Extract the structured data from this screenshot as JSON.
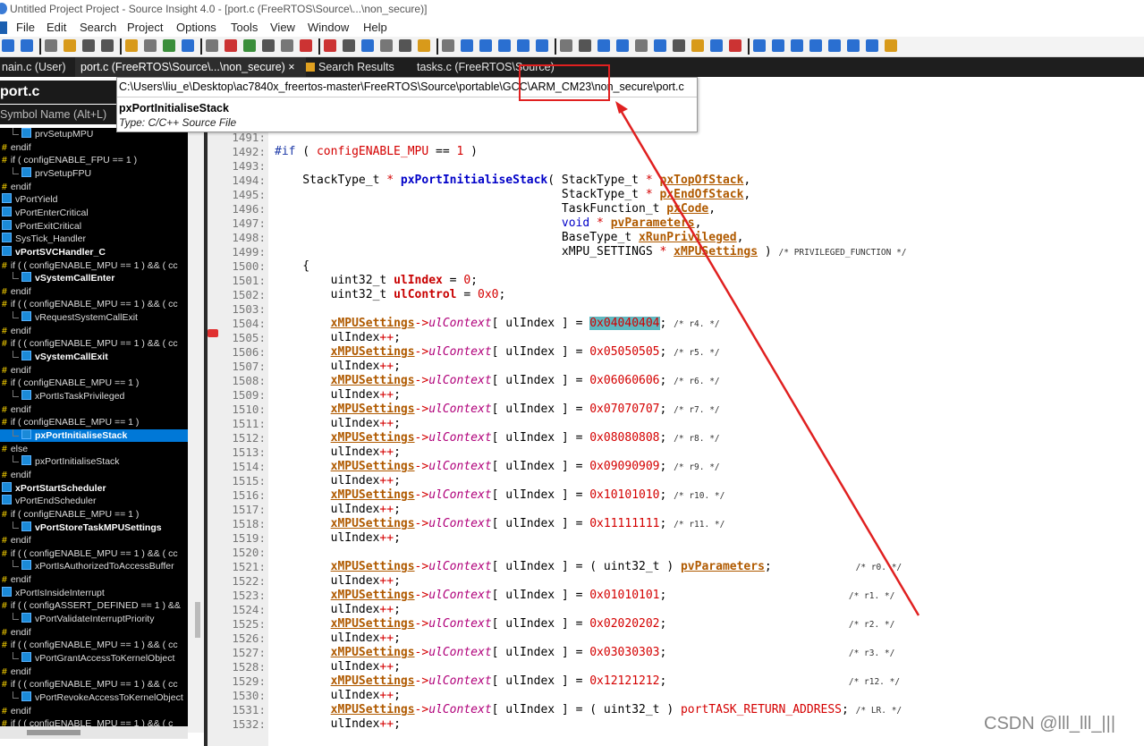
{
  "window": {
    "title": "Untitled Project Project - Source Insight 4.0 - [port.c (FreeRTOS\\Source\\...\\non_secure)]"
  },
  "menu": [
    "File",
    "Edit",
    "Search",
    "Project",
    "Options",
    "Tools",
    "View",
    "Window",
    "Help"
  ],
  "tabs": [
    {
      "label": "nain.c (User)"
    },
    {
      "label": "port.c (FreeRTOS\\Source\\...\\non_secure)",
      "close": "×"
    },
    {
      "label": "Search Results"
    },
    {
      "label": "tasks.c (FreeRTOS\\Source)"
    }
  ],
  "symbol_panel": {
    "title": "port.c",
    "search_placeholder": "Symbol Name (Alt+L)",
    "items": [
      {
        "label": "prvSetupMPU",
        "kind": "func",
        "indent": 1
      },
      {
        "label": "endif",
        "kind": "pp",
        "indent": 0
      },
      {
        "label": "if ( configENABLE_FPU == 1 )",
        "kind": "pp",
        "indent": 0
      },
      {
        "label": "prvSetupFPU",
        "kind": "func",
        "indent": 1
      },
      {
        "label": "endif",
        "kind": "pp",
        "indent": 0
      },
      {
        "label": "vPortYield",
        "kind": "func",
        "indent": 0
      },
      {
        "label": "vPortEnterCritical",
        "kind": "func",
        "indent": 0
      },
      {
        "label": "vPortExitCritical",
        "kind": "func",
        "indent": 0
      },
      {
        "label": "SysTick_Handler",
        "kind": "func",
        "indent": 0
      },
      {
        "label": "vPortSVCHandler_C",
        "kind": "func",
        "indent": 0,
        "bold": true
      },
      {
        "label": "if ( ( configENABLE_MPU == 1 ) && ( cc",
        "kind": "pp",
        "indent": 0
      },
      {
        "label": "vSystemCallEnter",
        "kind": "func",
        "indent": 1,
        "bold": true
      },
      {
        "label": "endif",
        "kind": "pp",
        "indent": 0
      },
      {
        "label": "if ( ( configENABLE_MPU == 1 ) && ( cc",
        "kind": "pp",
        "indent": 0
      },
      {
        "label": "vRequestSystemCallExit",
        "kind": "func",
        "indent": 1
      },
      {
        "label": "endif",
        "kind": "pp",
        "indent": 0
      },
      {
        "label": "if ( ( configENABLE_MPU == 1 ) && ( cc",
        "kind": "pp",
        "indent": 0
      },
      {
        "label": "vSystemCallExit",
        "kind": "func",
        "indent": 1,
        "bold": true
      },
      {
        "label": "endif",
        "kind": "pp",
        "indent": 0
      },
      {
        "label": "if ( configENABLE_MPU == 1 )",
        "kind": "pp",
        "indent": 0
      },
      {
        "label": "xPortIsTaskPrivileged",
        "kind": "func",
        "indent": 1
      },
      {
        "label": "endif",
        "kind": "pp",
        "indent": 0
      },
      {
        "label": "if ( configENABLE_MPU == 1 )",
        "kind": "pp",
        "indent": 0
      },
      {
        "label": "pxPortInitialiseStack",
        "kind": "func",
        "indent": 1,
        "selected": true
      },
      {
        "label": "else",
        "kind": "pp",
        "indent": 0
      },
      {
        "label": "pxPortInitialiseStack",
        "kind": "func",
        "indent": 1
      },
      {
        "label": "endif",
        "kind": "pp",
        "indent": 0
      },
      {
        "label": "xPortStartScheduler",
        "kind": "func",
        "indent": 0,
        "bold": true
      },
      {
        "label": "vPortEndScheduler",
        "kind": "func",
        "indent": 0
      },
      {
        "label": "if ( configENABLE_MPU == 1 )",
        "kind": "pp",
        "indent": 0
      },
      {
        "label": "vPortStoreTaskMPUSettings",
        "kind": "func",
        "indent": 1,
        "bold": true
      },
      {
        "label": "endif",
        "kind": "pp",
        "indent": 0
      },
      {
        "label": "if ( ( configENABLE_MPU == 1 ) && ( cc",
        "kind": "pp",
        "indent": 0
      },
      {
        "label": "xPortIsAuthorizedToAccessBuffer",
        "kind": "func",
        "indent": 1
      },
      {
        "label": "endif",
        "kind": "pp",
        "indent": 0
      },
      {
        "label": "xPortIsInsideInterrupt",
        "kind": "func",
        "indent": 0
      },
      {
        "label": "if ( ( configASSERT_DEFINED == 1 ) &&",
        "kind": "pp",
        "indent": 0
      },
      {
        "label": "vPortValidateInterruptPriority",
        "kind": "func",
        "indent": 1
      },
      {
        "label": "endif",
        "kind": "pp",
        "indent": 0
      },
      {
        "label": "if ( ( configENABLE_MPU == 1 ) && ( cc",
        "kind": "pp",
        "indent": 0
      },
      {
        "label": "vPortGrantAccessToKernelObject",
        "kind": "func",
        "indent": 1
      },
      {
        "label": "endif",
        "kind": "pp",
        "indent": 0
      },
      {
        "label": "if ( ( configENABLE_MPU == 1 ) && ( cc",
        "kind": "pp",
        "indent": 0
      },
      {
        "label": "vPortRevokeAccessToKernelObject",
        "kind": "func",
        "indent": 1
      },
      {
        "label": "endif",
        "kind": "pp",
        "indent": 0
      },
      {
        "label": "if ( ( configENABLE_MPU == 1 ) && ( c",
        "kind": "pp",
        "indent": 0
      }
    ]
  },
  "tooltip": {
    "path": "C:\\Users\\liu_e\\Desktop\\ac7840x_freertos-master\\FreeRTOS\\Source\\portable\\GCC\\ARM_CM23\\non_secure\\port.c",
    "symbol": "pxPortInitialiseStack",
    "type": "Type: C/C++ Source File"
  },
  "code_lines": [
    {
      "n": "1490:",
      "html": "<span class='cm'>/* -----------------------------------------------------------*/</span>"
    },
    {
      "n": "1491:",
      "html": ""
    },
    {
      "n": "1492:",
      "html": "<span class='pp'>#if</span> ( <span class='op'>configENABLE_MPU</span> == <span class='num'>1</span> )"
    },
    {
      "n": "1493:",
      "html": ""
    },
    {
      "n": "1494:",
      "html": "    StackType_t <span class='op'>*</span> <span class='fn'>pxPortInitialiseStack</span>( StackType_t <span class='op'>*</span> <span class='par'>pxTopOfStack</span>,"
    },
    {
      "n": "1495:",
      "html": "                                         StackType_t <span class='op'>*</span> <span class='par'>pxEndOfStack</span>,"
    },
    {
      "n": "1496:",
      "html": "                                         TaskFunction_t <span class='par'>pxCode</span>,"
    },
    {
      "n": "1497:",
      "html": "                                         <span class='kw'>void</span> <span class='op'>*</span> <span class='par'>pvParameters</span>,"
    },
    {
      "n": "1498:",
      "html": "                                         BaseType_t <span class='par'>xRunPrivileged</span>,"
    },
    {
      "n": "1499:",
      "html": "                                         xMPU_SETTINGS <span class='op'>*</span> <span class='par'>xMPUSettings</span> ) <span class='cm'>/* PRIVILEGED_FUNCTION */</span>"
    },
    {
      "n": "1500:",
      "html": "    {"
    },
    {
      "n": "1501:",
      "html": "        uint32_t <span class='var'>ulIndex</span> = <span class='num'>0</span>;"
    },
    {
      "n": "1502:",
      "html": "        uint32_t <span class='var'>ulControl</span> = <span class='num'>0x0</span>;"
    },
    {
      "n": "1503:",
      "html": ""
    },
    {
      "n": "1504:",
      "html": "        <span class='par'>xMPUSettings</span><span class='op'>-></span><span class='field'>ulContext</span>[ ulIndex ] = <span class='num hl'>0x04040404</span>; <span class='cm'>/* r4. */</span>"
    },
    {
      "n": "1505:",
      "html": "        ulIndex<span class='op'>++</span>;"
    },
    {
      "n": "1506:",
      "html": "        <span class='par'>xMPUSettings</span><span class='op'>-></span><span class='field'>ulContext</span>[ ulIndex ] = <span class='num'>0x05050505</span>; <span class='cm'>/* r5. */</span>"
    },
    {
      "n": "1507:",
      "html": "        ulIndex<span class='op'>++</span>;"
    },
    {
      "n": "1508:",
      "html": "        <span class='par'>xMPUSettings</span><span class='op'>-></span><span class='field'>ulContext</span>[ ulIndex ] = <span class='num'>0x06060606</span>; <span class='cm'>/* r6. */</span>"
    },
    {
      "n": "1509:",
      "html": "        ulIndex<span class='op'>++</span>;"
    },
    {
      "n": "1510:",
      "html": "        <span class='par'>xMPUSettings</span><span class='op'>-></span><span class='field'>ulContext</span>[ ulIndex ] = <span class='num'>0x07070707</span>; <span class='cm'>/* r7. */</span>"
    },
    {
      "n": "1511:",
      "html": "        ulIndex<span class='op'>++</span>;"
    },
    {
      "n": "1512:",
      "html": "        <span class='par'>xMPUSettings</span><span class='op'>-></span><span class='field'>ulContext</span>[ ulIndex ] = <span class='num'>0x08080808</span>; <span class='cm'>/* r8. */</span>"
    },
    {
      "n": "1513:",
      "html": "        ulIndex<span class='op'>++</span>;"
    },
    {
      "n": "1514:",
      "html": "        <span class='par'>xMPUSettings</span><span class='op'>-></span><span class='field'>ulContext</span>[ ulIndex ] = <span class='num'>0x09090909</span>; <span class='cm'>/* r9. */</span>"
    },
    {
      "n": "1515:",
      "html": "        ulIndex<span class='op'>++</span>;"
    },
    {
      "n": "1516:",
      "html": "        <span class='par'>xMPUSettings</span><span class='op'>-></span><span class='field'>ulContext</span>[ ulIndex ] = <span class='num'>0x10101010</span>; <span class='cm'>/* r10. */</span>"
    },
    {
      "n": "1517:",
      "html": "        ulIndex<span class='op'>++</span>;"
    },
    {
      "n": "1518:",
      "html": "        <span class='par'>xMPUSettings</span><span class='op'>-></span><span class='field'>ulContext</span>[ ulIndex ] = <span class='num'>0x11111111</span>; <span class='cm'>/* r11. */</span>"
    },
    {
      "n": "1519:",
      "html": "        ulIndex<span class='op'>++</span>;"
    },
    {
      "n": "1520:",
      "html": ""
    },
    {
      "n": "1521:",
      "html": "        <span class='par'>xMPUSettings</span><span class='op'>-></span><span class='field'>ulContext</span>[ ulIndex ] = ( uint32_t ) <span class='par'>pvParameters</span>;            <span class='cm'>/* r0. */</span>"
    },
    {
      "n": "1522:",
      "html": "        ulIndex<span class='op'>++</span>;"
    },
    {
      "n": "1523:",
      "html": "        <span class='par'>xMPUSettings</span><span class='op'>-></span><span class='field'>ulContext</span>[ ulIndex ] = <span class='num'>0x01010101</span>;                          <span class='cm'>/* r1. */</span>"
    },
    {
      "n": "1524:",
      "html": "        ulIndex<span class='op'>++</span>;"
    },
    {
      "n": "1525:",
      "html": "        <span class='par'>xMPUSettings</span><span class='op'>-></span><span class='field'>ulContext</span>[ ulIndex ] = <span class='num'>0x02020202</span>;                          <span class='cm'>/* r2. */</span>"
    },
    {
      "n": "1526:",
      "html": "        ulIndex<span class='op'>++</span>;"
    },
    {
      "n": "1527:",
      "html": "        <span class='par'>xMPUSettings</span><span class='op'>-></span><span class='field'>ulContext</span>[ ulIndex ] = <span class='num'>0x03030303</span>;                          <span class='cm'>/* r3. */</span>"
    },
    {
      "n": "1528:",
      "html": "        ulIndex<span class='op'>++</span>;"
    },
    {
      "n": "1529:",
      "html": "        <span class='par'>xMPUSettings</span><span class='op'>-></span><span class='field'>ulContext</span>[ ulIndex ] = <span class='num'>0x12121212</span>;                          <span class='cm'>/* r12. */</span>"
    },
    {
      "n": "1530:",
      "html": "        ulIndex<span class='op'>++</span>;"
    },
    {
      "n": "1531:",
      "html": "        <span class='par'>xMPUSettings</span><span class='op'>-></span><span class='field'>ulContext</span>[ ulIndex ] = ( uint32_t ) <span class='op'>portTASK_RETURN_ADDRESS</span>; <span class='cm'>/* LR. */</span>"
    },
    {
      "n": "1532:",
      "html": "        ulIndex<span class='op'>++</span>;"
    }
  ],
  "watermark": "CSDN @lll_lll_|||",
  "annotation_color": "#e02020"
}
